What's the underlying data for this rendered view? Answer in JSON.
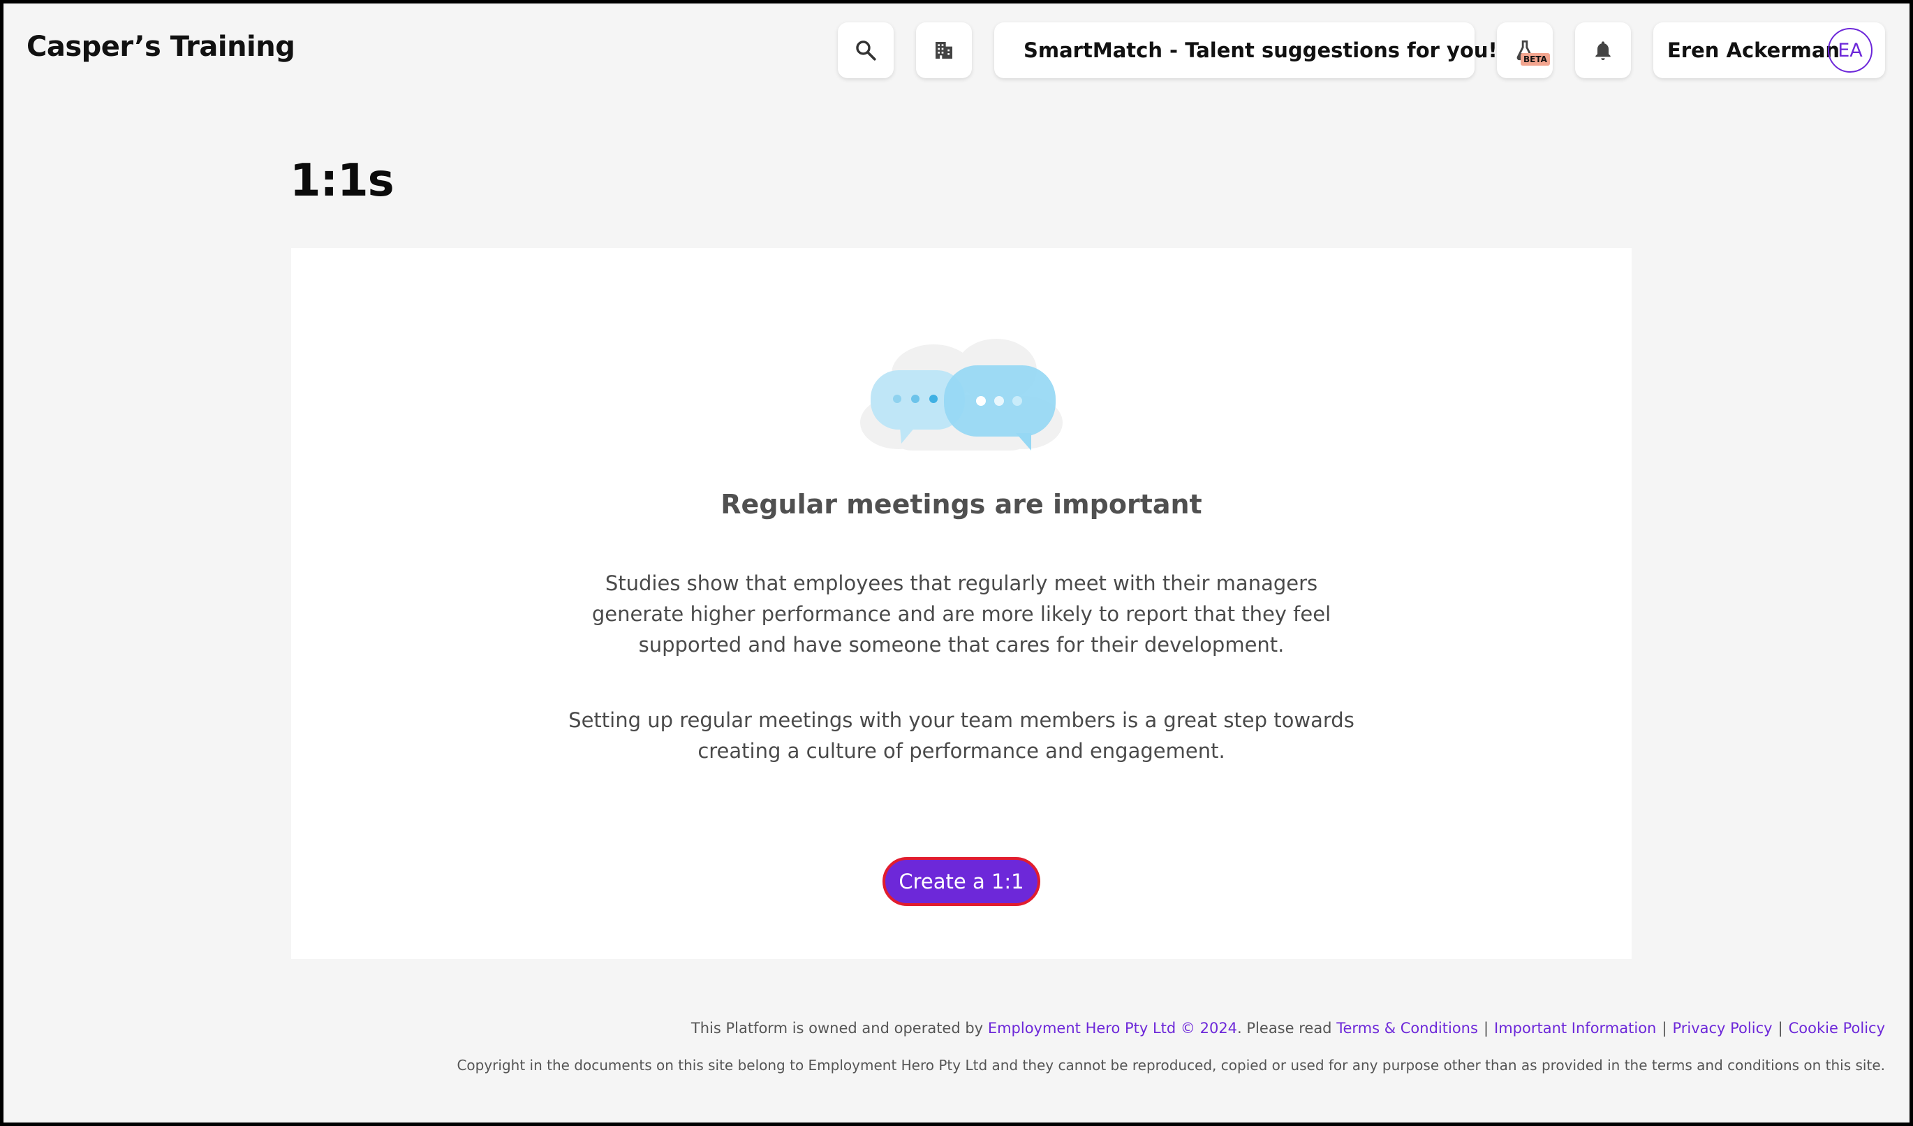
{
  "header": {
    "org_name": "Casper’s Training",
    "smartmatch_label": "SmartMatch - Talent suggestions for you!",
    "beta_badge": "BETA",
    "user_name": "Eren Ackerman",
    "user_initials": "EA",
    "icons": [
      "search-icon",
      "building-icon",
      "sparkle-icon",
      "flask-icon",
      "bell-icon"
    ]
  },
  "main": {
    "title": "1:1s",
    "card": {
      "heading": "Regular meetings are important",
      "paragraph1": "Studies show that employees that regularly meet with their managers generate higher performance and are more likely to report that they feel supported and have someone that cares for their development.",
      "paragraph2": "Setting up regular meetings with your team members is a great step towards creating a culture of performance and engagement.",
      "cta_label": "Create a 1:1"
    }
  },
  "footer": {
    "owned_text": "This Platform is owned and operated by",
    "company_link": "Employment Hero Pty Ltd © 2024",
    "please_read": ". Please read",
    "links": [
      "Terms & Conditions",
      "Important Information",
      "Privacy Policy",
      "Cookie Policy"
    ],
    "copyright": "Copyright in the documents on this site belong to Employment Hero Pty Ltd and they cannot be reproduced, copied or used for any purpose other than as provided in the terms and conditions on this site."
  },
  "colors": {
    "accent": "#6d28d9",
    "cta_border": "#e11d2e",
    "background": "#f5f5f5"
  }
}
